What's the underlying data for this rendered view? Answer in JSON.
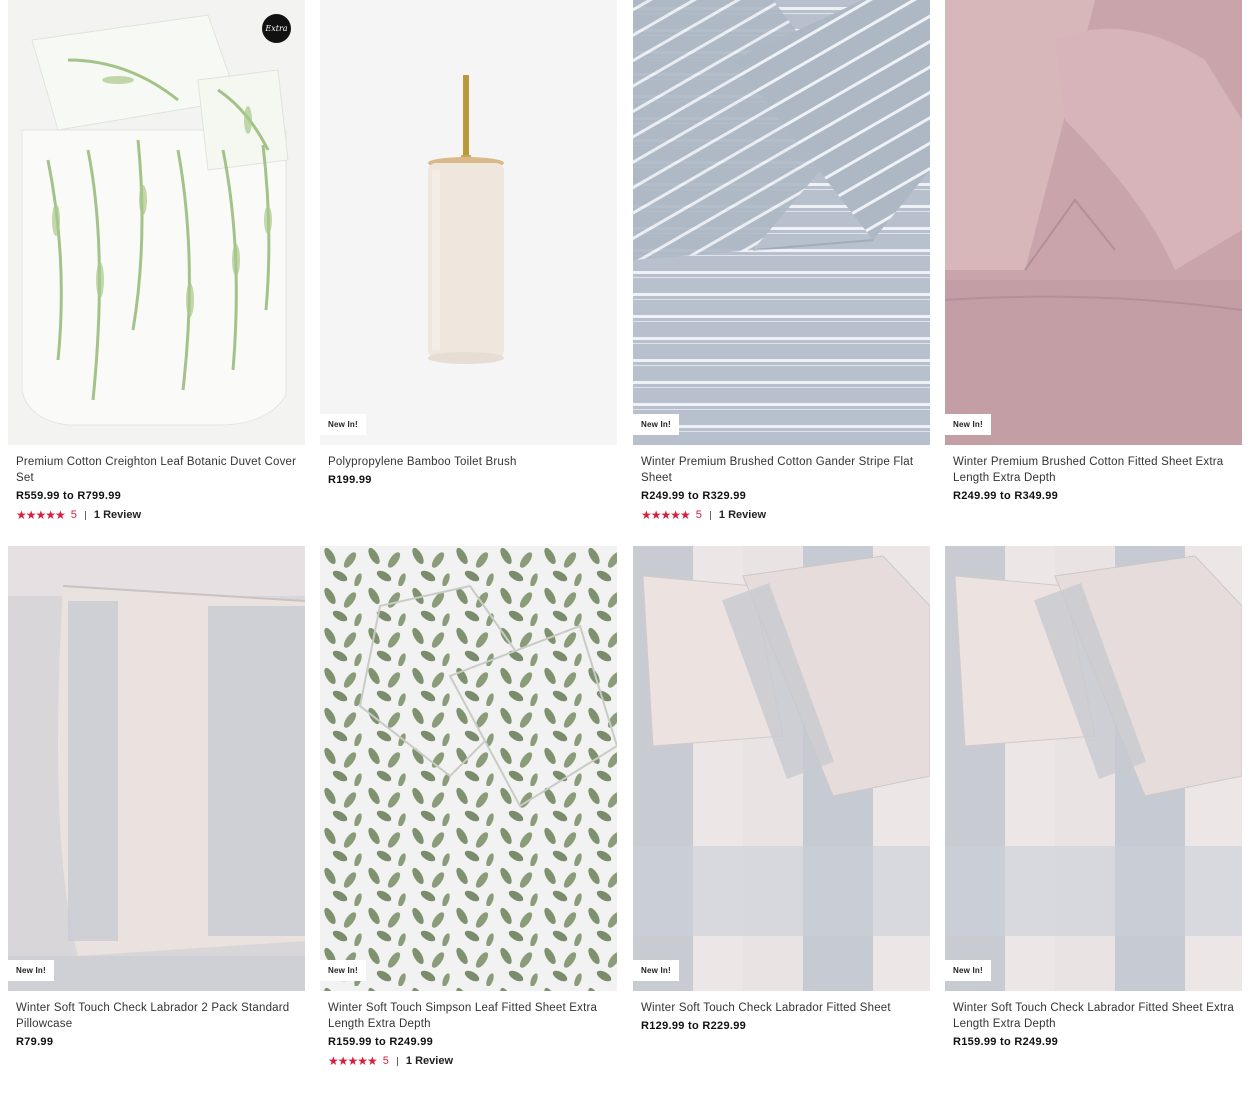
{
  "products": [
    {
      "title": "Premium Cotton Creighton Leaf Botanic Duvet Cover Set",
      "price": "R559.99 to R799.99",
      "badge": "",
      "logo_badge": "Extra",
      "rating": {
        "stars": "★★★★★",
        "score": "5",
        "reviews": "1 Review"
      },
      "image": "duvet-leaf-print-image"
    },
    {
      "title": "Polypropylene Bamboo Toilet Brush",
      "price": "R199.99",
      "badge": "New In!",
      "image": "toilet-brush-image"
    },
    {
      "title": "Winter Premium Brushed Cotton Gander Stripe Flat Sheet",
      "price": "R249.99 to R329.99",
      "badge": "New In!",
      "rating": {
        "stars": "★★★★★",
        "score": "5",
        "reviews": "1 Review"
      },
      "image": "stripe-sheet-image"
    },
    {
      "title": "Winter Premium Brushed Cotton Fitted Sheet Extra Length Extra Depth",
      "price": "R249.99 to R349.99",
      "badge": "New In!",
      "image": "pink-sheet-image"
    },
    {
      "title": "Winter Soft Touch Check Labrador 2 Pack Standard Pillowcase",
      "price": "R79.99",
      "badge": "New In!",
      "image": "check-pillowcase-image"
    },
    {
      "title": "Winter Soft Touch Simpson Leaf Fitted Sheet Extra Length Extra Depth",
      "price": "R159.99 to R249.99",
      "badge": "New In!",
      "rating": {
        "stars": "★★★★★",
        "score": "5",
        "reviews": "1 Review"
      },
      "image": "leaf-sheet-image"
    },
    {
      "title": "Winter Soft Touch Check Labrador Fitted Sheet",
      "price": "R129.99 to R229.99",
      "badge": "New In!",
      "image": "check-fitted-sheet-image"
    },
    {
      "title": "Winter Soft Touch Check Labrador Fitted Sheet Extra Length Extra Depth",
      "price": "R159.99 to R249.99",
      "badge": "New In!",
      "image": "check-fitted-sheet-xl-image"
    }
  ],
  "colors": {
    "rating_red": "#d61f3d",
    "price_text": "#111111",
    "title_text": "#333333"
  }
}
